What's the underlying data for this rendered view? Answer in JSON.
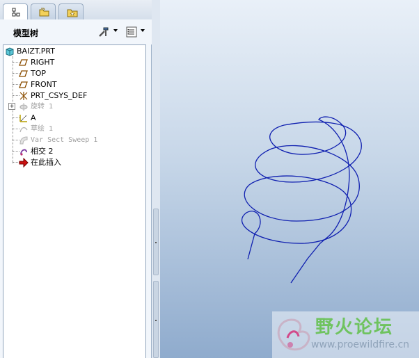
{
  "panel": {
    "tabs": [
      {
        "name": "model-tree-tab",
        "icon": "tree-structure-icon",
        "active": true
      },
      {
        "name": "folder-browser-tab",
        "icon": "folders-icon",
        "active": false
      },
      {
        "name": "favorites-tab",
        "icon": "favorites-folder-icon",
        "active": false
      }
    ],
    "title": "模型树"
  },
  "tree": {
    "root": {
      "label": "BAIZT.PRT",
      "icon": "part-icon"
    },
    "items": [
      {
        "label": "RIGHT",
        "icon": "datum-plane-icon",
        "suppressed": false
      },
      {
        "label": "TOP",
        "icon": "datum-plane-icon",
        "suppressed": false
      },
      {
        "label": "FRONT",
        "icon": "datum-plane-icon",
        "suppressed": false
      },
      {
        "label": "PRT_CSYS_DEF",
        "icon": "coordinate-system-icon",
        "suppressed": false
      },
      {
        "label": "旋转 1",
        "icon": "revolve-icon",
        "suppressed": true
      },
      {
        "label": "A",
        "icon": "datum-axis-icon",
        "suppressed": false
      },
      {
        "label": "草绘 1",
        "icon": "sketch-icon",
        "suppressed": true
      },
      {
        "label": "Var Sect Sweep 1",
        "icon": "sweep-icon",
        "suppressed": true
      },
      {
        "label": "相交 2",
        "icon": "intersect-icon",
        "suppressed": false
      },
      {
        "label": "在此插入",
        "icon": "insert-here-arrow-icon",
        "suppressed": false
      }
    ]
  },
  "watermark": {
    "title": "野火论坛",
    "url": "www.proewildfire.cn"
  },
  "colors": {
    "curve": "#1020b0",
    "accent_red": "#cc1111",
    "watermark_green": "#6fc35f"
  }
}
